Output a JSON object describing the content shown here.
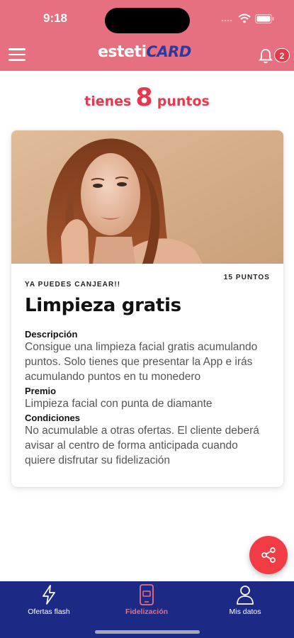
{
  "status_bar": {
    "time": "9:18"
  },
  "header": {
    "logo_part1": "esteti",
    "logo_part2": "CARD",
    "notification_count": "2",
    "color": "#e6707f"
  },
  "points": {
    "prefix": "tienes",
    "value": "8",
    "suffix": "puntos"
  },
  "reward_card": {
    "eyebrow": "YA PUEDES CANJEAR!!",
    "points_required": "15 PUNTOS",
    "title": "Limpieza gratis",
    "sections": [
      {
        "label": "Descripción",
        "text": "Consigue una limpieza facial gratis acumulando puntos. Solo tienes que presentar la App e irás acumulando puntos en tu monedero"
      },
      {
        "label": "Premio",
        "text": "Limpieza facial con punta de diamante"
      },
      {
        "label": "Condiciones",
        "text": "No acumulable a otras ofertas. El cliente deberá avisar al centro de forma anticipada cuando quiere disfrutar su fidelización"
      }
    ]
  },
  "fab": {
    "icon": "share-icon",
    "color": "#f23c45"
  },
  "bottom_nav": {
    "items": [
      {
        "label": "Ofertas flash",
        "icon": "lightning-icon",
        "active": false
      },
      {
        "label": "Fidelización",
        "icon": "phone-card-icon",
        "active": true
      },
      {
        "label": "Mis datos",
        "icon": "user-icon",
        "active": false
      }
    ],
    "background": "#1c2a86"
  }
}
